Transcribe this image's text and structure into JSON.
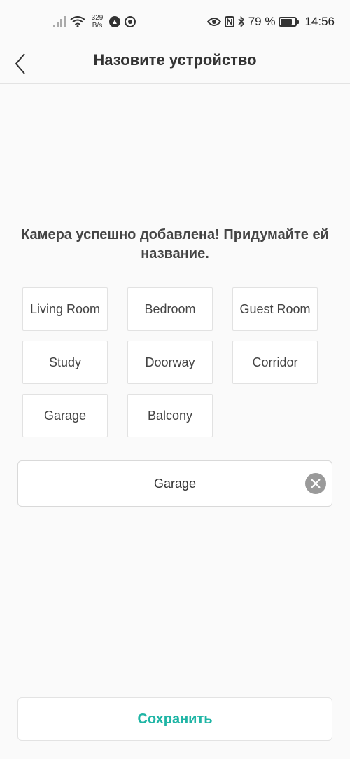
{
  "status_bar": {
    "net_speed_value": "329",
    "net_speed_unit": "B/s",
    "battery_percent": "79 %",
    "battery_level": 0.79,
    "time": "14:56"
  },
  "header": {
    "title": "Назовите устройство"
  },
  "prompt": "Камера успешно добавлена! Придумайте ей название.",
  "chips": [
    {
      "label": "Living Room"
    },
    {
      "label": "Bedroom"
    },
    {
      "label": "Guest Room"
    },
    {
      "label": "Study"
    },
    {
      "label": "Doorway"
    },
    {
      "label": "Corridor"
    },
    {
      "label": "Garage"
    },
    {
      "label": "Balcony"
    }
  ],
  "name_field": {
    "value": "Garage"
  },
  "save_label": "Сохранить",
  "colors": {
    "accent": "#1fb5a5",
    "background": "#fafafa",
    "clear_button": "#9a9a9a"
  }
}
